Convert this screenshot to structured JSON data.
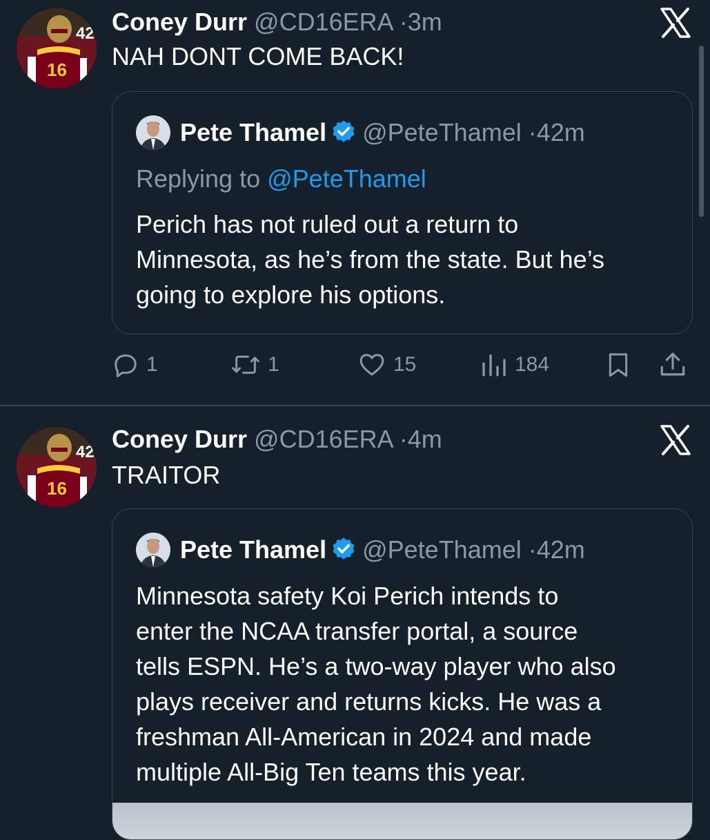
{
  "tweets": [
    {
      "author_name": "Coney Durr",
      "author_handle": "@CD16ERA",
      "separator": "·",
      "time": "3m",
      "text": "NAH DONT COME BACK!",
      "quote": {
        "author_name": "Pete Thamel",
        "author_handle": "@PeteThamel",
        "separator": "·",
        "time": "42m",
        "replying_prefix": "Replying to ",
        "replying_handle": "@PeteThamel",
        "lines": [
          "Perich has not ruled out a return to",
          "Minnesota, as he’s from the state. But he’s",
          "going to explore his options."
        ]
      },
      "actions": {
        "replies": "1",
        "reposts": "1",
        "likes": "15",
        "views": "184"
      }
    },
    {
      "author_name": "Coney Durr",
      "author_handle": "@CD16ERA",
      "separator": "·",
      "time": "4m",
      "text": "TRAITOR",
      "quote": {
        "author_name": "Pete Thamel",
        "author_handle": "@PeteThamel",
        "separator": "·",
        "time": "42m",
        "lines": [
          "Minnesota safety Koi Perich intends to",
          "enter the NCAA transfer portal, a source",
          "tells ESPN. He’s a two-way player who also",
          "plays receiver and returns kicks. He was a",
          "freshman All-American in 2024 and made",
          "multiple All-Big Ten teams this year."
        ]
      }
    }
  ],
  "avatar_jersey_number": "16",
  "avatar_bg_number": "42",
  "colors": {
    "background": "#15202b",
    "text": "#ffffff",
    "muted": "#8b98a5",
    "link": "#1d9bf0",
    "border": "#38444d",
    "maroon": "#7a0019",
    "gold": "#ffcc33"
  },
  "icons": [
    "x-logo-icon",
    "verified-badge-icon",
    "reply-icon",
    "repost-icon",
    "like-icon",
    "views-icon",
    "bookmark-icon",
    "share-icon"
  ]
}
